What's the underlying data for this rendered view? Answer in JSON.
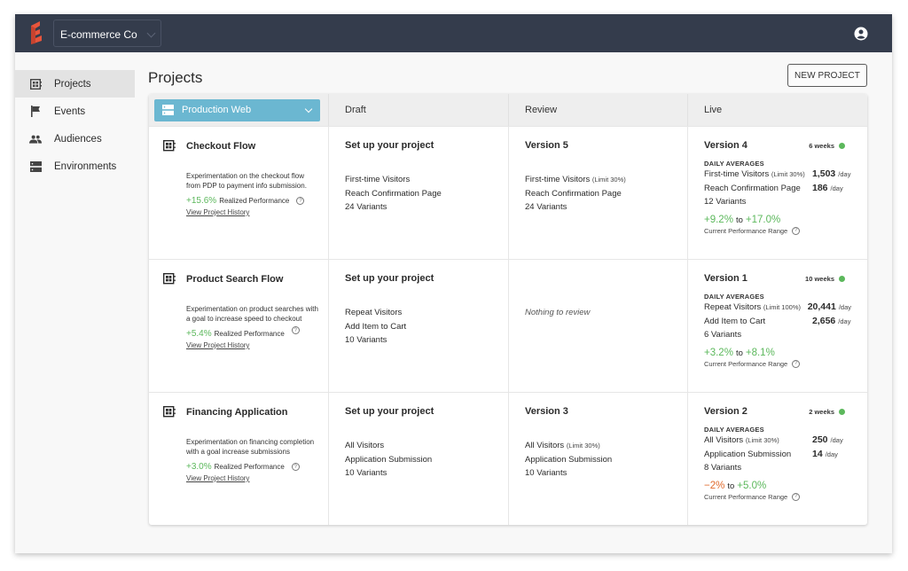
{
  "topbar": {
    "org_name": "E-commerce Co",
    "logo_color": "#e8553c"
  },
  "sidebar": {
    "items": [
      {
        "label": "Projects",
        "icon": "projects-icon",
        "active": true
      },
      {
        "label": "Events",
        "icon": "flag-icon",
        "active": false
      },
      {
        "label": "Audiences",
        "icon": "people-icon",
        "active": false
      },
      {
        "label": "Environments",
        "icon": "server-icon",
        "active": false
      }
    ]
  },
  "page": {
    "title": "Projects",
    "new_project_label": "NEW PROJECT"
  },
  "table": {
    "environment": "Production Web",
    "columns": [
      "Draft",
      "Review",
      "Live"
    ],
    "daily_averages_label": "DAILY AVERAGES",
    "realized_label": "Realized Performance",
    "history_label": "View Project History",
    "range_label": "Current Performance Range",
    "to_label": "to",
    "per_day": "/day",
    "rows": [
      {
        "name": "Checkout Flow",
        "description": "Experimentation on the checkout flow from PDP to payment info submission.",
        "realized": "+15.6%",
        "draft": {
          "title": "Set up your project",
          "audience": "First-time Visitors",
          "goal": "Reach Confirmation Page",
          "variants": "24 Variants"
        },
        "review": {
          "title": "Version 5",
          "audience": "First-time Visitors",
          "limit": "(Limit 30%)",
          "goal": "Reach Confirmation Page",
          "variants": "24 Variants"
        },
        "live": {
          "title": "Version 4",
          "duration": "6 weeks",
          "audience": "First-time Visitors",
          "limit": "(Limit 30%)",
          "audience_value": "1,503",
          "goal": "Reach Confirmation Page",
          "goal_value": "186",
          "variants": "12 Variants",
          "range_low": "+9.2%",
          "range_high": "+17.0%"
        }
      },
      {
        "name": "Product Search Flow",
        "description": "Experimentation on product searches with a goal to increase speed to checkout",
        "realized": "+5.4%",
        "draft": {
          "title": "Set up your project",
          "audience": "Repeat Visitors",
          "goal": "Add Item to Cart",
          "variants": "10 Variants"
        },
        "review": {
          "empty_text": "Nothing to review"
        },
        "live": {
          "title": "Version 1",
          "duration": "10 weeks",
          "audience": "Repeat Visitors",
          "limit": "(Limit 100%)",
          "audience_value": "20,441",
          "goal": "Add Item to Cart",
          "goal_value": "2,656",
          "variants": "6 Variants",
          "range_low": "+3.2%",
          "range_high": "+8.1%"
        }
      },
      {
        "name": "Financing Application",
        "description": "Experimentation on financing completion with a goal increase submissions",
        "realized": "+3.0%",
        "draft": {
          "title": "Set up your project",
          "audience": "All Visitors",
          "goal": "Application Submission",
          "variants": "10 Variants"
        },
        "review": {
          "title": "Version 3",
          "audience": "All Visitors",
          "limit": "(Limit 30%)",
          "goal": "Application Submission",
          "variants": "10 Variants"
        },
        "live": {
          "title": "Version 2",
          "duration": "2 weeks",
          "audience": "All Visitors",
          "limit": "(Limit 30%)",
          "audience_value": "250",
          "goal": "Application Submission",
          "goal_value": "14",
          "variants": "8 Variants",
          "range_low": "−2%",
          "range_high": "+5.0%"
        }
      }
    ]
  },
  "colors": {
    "topbar": "#343c4c",
    "accent": "#6bb7d1",
    "positive": "#5cb85c",
    "negative": "#e06a2c",
    "live_status": "#5cb85c"
  }
}
